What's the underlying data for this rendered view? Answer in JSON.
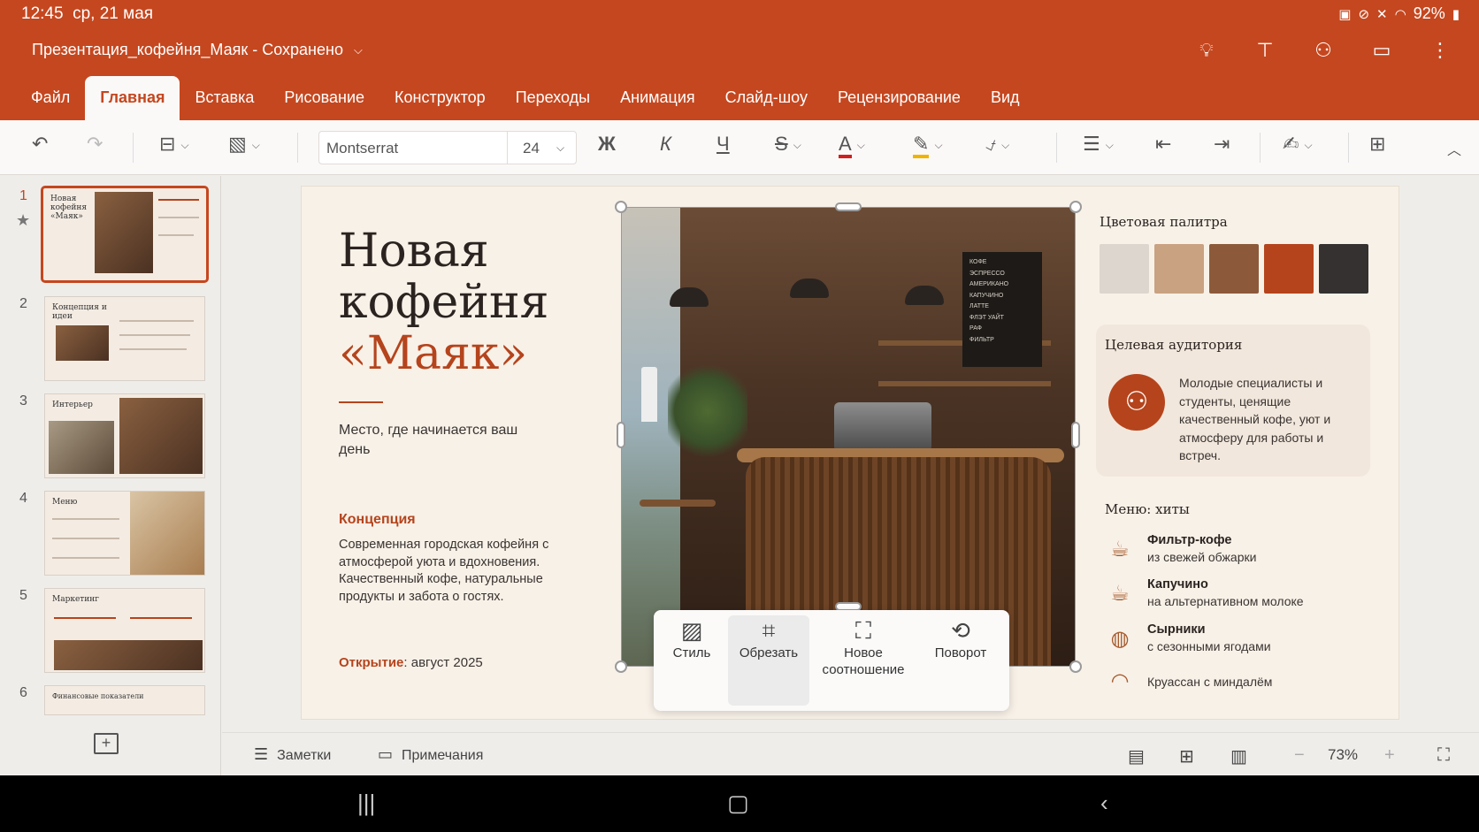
{
  "status": {
    "time": "12:45",
    "date": "ср, 21 мая",
    "battery": "92%"
  },
  "app": {
    "doc_title": "Презентация_кофейня_Маяк - Сохранено"
  },
  "tabs": [
    "Файл",
    "Главная",
    "Вставка",
    "Рисование",
    "Конструктор",
    "Переходы",
    "Анимация",
    "Слайд-шоу",
    "Рецензирование",
    "Вид"
  ],
  "active_tab": "Главная",
  "ribbon": {
    "font_name": "Montserrat",
    "font_size": "24",
    "bold": "Ж",
    "italic": "К",
    "underline": "Ч",
    "strike": "S",
    "font_color_glyph": "A",
    "font_color": "#d11f1f",
    "highlight_color": "#f0b400"
  },
  "thumbnails": [
    {
      "num": "1",
      "title": "Новая кофейня «Маяк»"
    },
    {
      "num": "2",
      "title": "Концепция и идеи"
    },
    {
      "num": "3",
      "title": "Интерьер"
    },
    {
      "num": "4",
      "title": "Меню"
    },
    {
      "num": "5",
      "title": "Маркетинг"
    },
    {
      "num": "6",
      "title": "Финансовые показатели"
    }
  ],
  "slide": {
    "title_line1": "Новая",
    "title_line2": "кофейня",
    "title_line3": "«Маяк»",
    "tagline": "Место, где начинается ваш день",
    "concept_heading": "Концепция",
    "concept_text": "Современная городская кофейня с атмосферой уюта и вдохновения. Качественный кофе, натуральные продукты и забота о гостях.",
    "opening_label": "Открытие",
    "opening_value": ": август 2025",
    "menu_board": [
      "КОФЕ",
      "ЭСПРЕССО",
      "АМЕРИКАНО",
      "КАПУЧИНО",
      "ЛАТТЕ",
      "ФЛЭТ УАЙТ",
      "РАФ",
      "ФИЛЬТР"
    ],
    "palette_heading": "Цветовая палитра",
    "palette": [
      "#dcd6ce",
      "#c9a282",
      "#8c5a3a",
      "#b5441c",
      "#343130"
    ],
    "audience_heading": "Целевая аудитория",
    "audience_text": "Молодые специалисты и студенты, ценящие качественный кофе, уют и атмосферу для работы и встреч.",
    "menu_heading": "Меню: хиты",
    "menu_items": [
      {
        "name": "Фильтр-кофе",
        "desc": "из свежей обжарки",
        "icon": "coffee-cup-icon"
      },
      {
        "name": "Капучино",
        "desc": "на альтернативном молоке",
        "icon": "cappuccino-icon"
      },
      {
        "name": "Сырники",
        "desc": "с сезонными ягодами",
        "icon": "plate-icon"
      },
      {
        "name": "Круассан с миндалём",
        "desc": "",
        "icon": "croissant-icon"
      }
    ]
  },
  "picture_toolbar": {
    "style": "Стиль",
    "crop": "Обрезать",
    "aspect_line1": "Новое",
    "aspect_line2": "соотношение",
    "rotate": "Поворот"
  },
  "bottom": {
    "notes": "Заметки",
    "comments": "Примечания",
    "zoom": "73%"
  }
}
